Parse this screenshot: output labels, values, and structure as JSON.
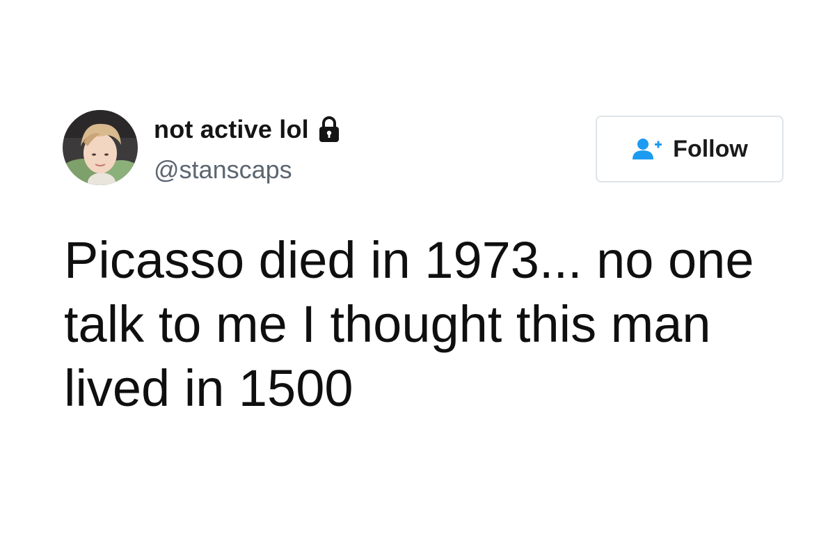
{
  "profile": {
    "display_name": "not active lol",
    "handle": "@stanscaps",
    "avatar_icon": "avatar-photo",
    "lock_icon": "lock-icon"
  },
  "follow_button": {
    "label": "Follow",
    "icon": "add-user-icon",
    "icon_color": "#1d9bf0"
  },
  "tweet": {
    "text": "Picasso died in 1973... no one talk to me I thought this man lived in 1500"
  }
}
